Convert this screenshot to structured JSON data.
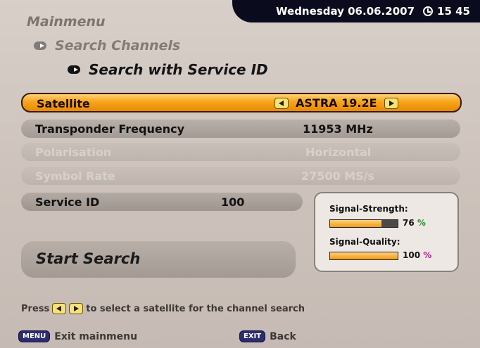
{
  "header": {
    "date": "Wednesday 06.06.2007",
    "time": "15 45"
  },
  "breadcrumb": {
    "level1": "Mainmenu",
    "level2": "Search Channels",
    "level3": "Search with Service ID"
  },
  "rows": {
    "satellite": {
      "label": "Satellite",
      "value": "ASTRA 19.2E"
    },
    "transponder": {
      "label": "Transponder Frequency",
      "value": "11953 MHz"
    },
    "polarisation": {
      "label": "Polarisation",
      "value": "Horizontal"
    },
    "symbol_rate": {
      "label": "Symbol Rate",
      "value": "27500 MS/s"
    },
    "service_id": {
      "label": "Service ID",
      "value": "100"
    },
    "start": {
      "label": "Start Search"
    }
  },
  "signal": {
    "strength_label": "Signal-Strength:",
    "strength_value": "76",
    "strength_fraction": 0.76,
    "quality_label": "Signal-Quality:",
    "quality_value": "100",
    "quality_fraction": 1.0,
    "unit": "%"
  },
  "hint": {
    "pre": "Press",
    "post": "to select a satellite for the channel search"
  },
  "footer": {
    "menu_key": "MENU",
    "menu_label": "Exit mainmenu",
    "exit_key": "EXIT",
    "exit_label": "Back"
  },
  "icons": [
    "clock-icon",
    "arrow-icon",
    "left-button-icon",
    "right-button-icon"
  ],
  "colors": {
    "accent": "#f7a51a",
    "header_bg": "#0b0b1e",
    "key_bg": "#2b2d6e"
  }
}
